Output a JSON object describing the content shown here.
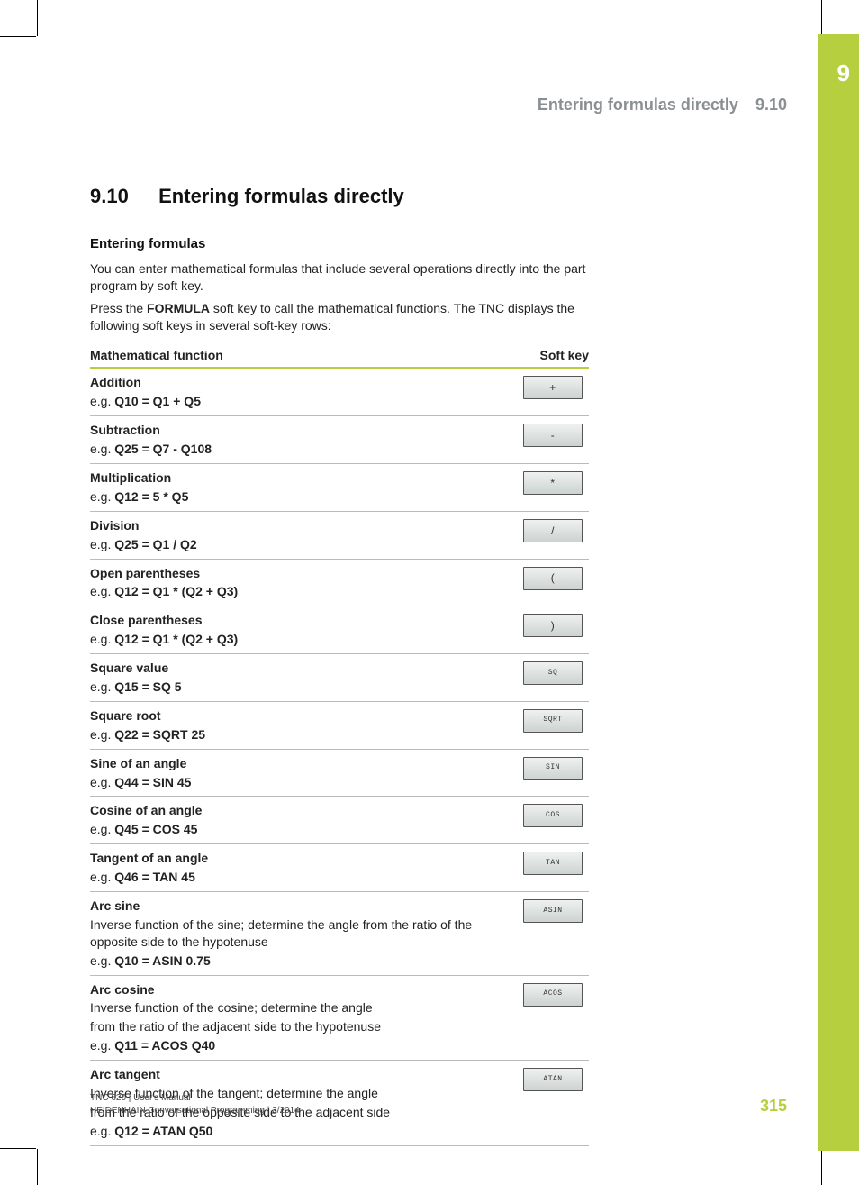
{
  "chapter_tab": "9",
  "running_header": {
    "title": "Entering formulas directly",
    "section": "9.10"
  },
  "heading": {
    "number": "9.10",
    "title": "Entering formulas directly"
  },
  "subheading": "Entering formulas",
  "paragraphs": {
    "0": "You can enter mathematical formulas that include several operations directly into the part program by soft key."
  },
  "paragraphs_p2": {
    "pre": "Press the ",
    "bold": "FORMULA",
    "post": " soft key to call the mathematical functions. The TNC displays the following soft keys in several soft-key rows:"
  },
  "table": {
    "headers": [
      "Mathematical function",
      "Soft key"
    ],
    "eg_label": "e.g. ",
    "rows": [
      {
        "name": "Addition",
        "desc": "",
        "desc2": "",
        "example": "Q10 = Q1 + Q5",
        "key": "+",
        "sym": true
      },
      {
        "name": "Subtraction",
        "desc": "",
        "desc2": "",
        "example": "Q25 = Q7 - Q108",
        "key": "-",
        "sym": true
      },
      {
        "name": "Multiplication",
        "desc": "",
        "desc2": "",
        "example": "Q12 = 5 * Q5",
        "key": "*",
        "sym": true
      },
      {
        "name": "Division",
        "desc": "",
        "desc2": "",
        "example": "Q25 = Q1 / Q2",
        "key": "/",
        "sym": true
      },
      {
        "name": "Open parentheses",
        "desc": "",
        "desc2": "",
        "example": "Q12 = Q1 * (Q2 + Q3)",
        "key": "(",
        "sym": true
      },
      {
        "name": "Close parentheses",
        "desc": "",
        "desc2": "",
        "example": "Q12 = Q1 * (Q2 + Q3)",
        "key": ")",
        "sym": true
      },
      {
        "name": "Square value",
        "desc": "",
        "desc2": "",
        "example": "Q15 = SQ 5",
        "key": "SQ",
        "sym": false
      },
      {
        "name": "Square root",
        "desc": "",
        "desc2": "",
        "example": "Q22 = SQRT 25",
        "key": "SQRT",
        "sym": false
      },
      {
        "name": "Sine of an angle",
        "desc": "",
        "desc2": "",
        "example": "Q44 = SIN 45",
        "key": "SIN",
        "sym": false
      },
      {
        "name": "Cosine of an angle",
        "desc": "",
        "desc2": "",
        "example": "Q45 = COS 45",
        "key": "COS",
        "sym": false
      },
      {
        "name": "Tangent of an angle",
        "desc": "",
        "desc2": "",
        "example": "Q46 = TAN 45",
        "key": "TAN",
        "sym": false
      },
      {
        "name": "Arc sine",
        "desc": "Inverse function of the sine; determine the angle from the ratio of the opposite side to the hypotenuse",
        "desc2": "",
        "example": "Q10 = ASIN 0.75",
        "key": "ASIN",
        "sym": false
      },
      {
        "name": "Arc cosine",
        "desc": "Inverse function of the cosine; determine the angle",
        "desc2": "from the ratio of the adjacent side to the hypotenuse",
        "example": "Q11 = ACOS Q40",
        "key": "ACOS",
        "sym": false
      },
      {
        "name": "Arc tangent",
        "desc": "Inverse function of the tangent; determine the angle",
        "desc2": "from the ratio of the opposite side to the adjacent side",
        "example": "Q12 = ATAN Q50",
        "key": "ATAN",
        "sym": false
      }
    ]
  },
  "footer": {
    "line1": "TNC 620 | User's Manual",
    "line2": "HEIDENHAIN Conversational Programming | 3/2014",
    "page": "315"
  }
}
